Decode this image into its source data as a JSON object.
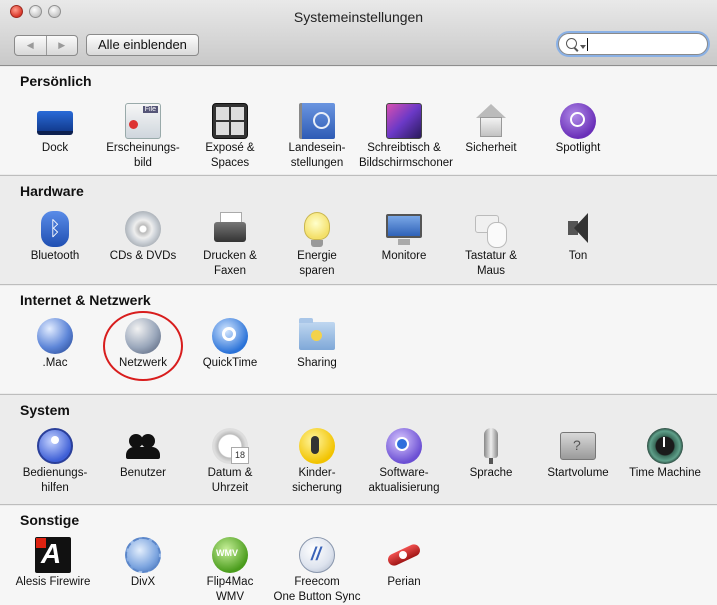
{
  "window": {
    "title": "Systemeinstellungen"
  },
  "toolbar": {
    "back_glyph": "◀",
    "forward_glyph": "▶",
    "show_all_label": "Alle einblenden",
    "search_value": ""
  },
  "sections": {
    "personal": {
      "title": "Persönlich",
      "items": [
        {
          "label": "Dock",
          "icon": "dock-icon"
        },
        {
          "label": "Erscheinungs-\nbild",
          "icon": "appearance-icon"
        },
        {
          "label": "Exposé &\nSpaces",
          "icon": "expose-spaces-icon"
        },
        {
          "label": "Landesein-\nstellungen",
          "icon": "international-icon"
        },
        {
          "label": "Schreibtisch &\nBildschirmschoner",
          "icon": "desktop-screensaver-icon"
        },
        {
          "label": "Sicherheit",
          "icon": "security-icon"
        },
        {
          "label": "Spotlight",
          "icon": "spotlight-icon"
        }
      ]
    },
    "hardware": {
      "title": "Hardware",
      "items": [
        {
          "label": "Bluetooth",
          "icon": "bluetooth-icon"
        },
        {
          "label": "CDs & DVDs",
          "icon": "cd-dvd-icon"
        },
        {
          "label": "Drucken &\nFaxen",
          "icon": "printer-icon"
        },
        {
          "label": "Energie\nsparen",
          "icon": "energy-saver-icon"
        },
        {
          "label": "Monitore",
          "icon": "monitor-icon"
        },
        {
          "label": "Tastatur &\nMaus",
          "icon": "keyboard-mouse-icon"
        },
        {
          "label": "Ton",
          "icon": "speaker-icon"
        }
      ]
    },
    "internet": {
      "title": "Internet & Netzwerk",
      "items": [
        {
          "label": ".Mac",
          "icon": "mac-globe-icon"
        },
        {
          "label": "Netzwerk",
          "icon": "network-globe-icon"
        },
        {
          "label": "QuickTime",
          "icon": "quicktime-icon"
        },
        {
          "label": "Sharing",
          "icon": "sharing-folder-icon"
        }
      ]
    },
    "system": {
      "title": "System",
      "items": [
        {
          "label": "Bedienungs-\nhilfen",
          "icon": "universal-access-icon"
        },
        {
          "label": "Benutzer",
          "icon": "accounts-icon"
        },
        {
          "label": "Datum &\nUhrzeit",
          "icon": "date-time-icon"
        },
        {
          "label": "Kinder-\nsicherung",
          "icon": "parental-controls-icon"
        },
        {
          "label": "Software-\naktualisierung",
          "icon": "software-update-icon"
        },
        {
          "label": "Sprache",
          "icon": "microphone-icon"
        },
        {
          "label": "Startvolume",
          "icon": "startup-disk-icon"
        },
        {
          "label": "Time Machine",
          "icon": "time-machine-icon"
        }
      ]
    },
    "other": {
      "title": "Sonstige",
      "items": [
        {
          "label": "Alesis Firewire",
          "icon": "alesis-icon"
        },
        {
          "label": "DivX",
          "icon": "divx-icon"
        },
        {
          "label": "Flip4Mac\nWMV",
          "icon": "wmv-icon"
        },
        {
          "label": "Freecom\nOne Button Sync",
          "icon": "freecom-icon"
        },
        {
          "label": "Perian",
          "icon": "perian-icon"
        }
      ]
    }
  }
}
